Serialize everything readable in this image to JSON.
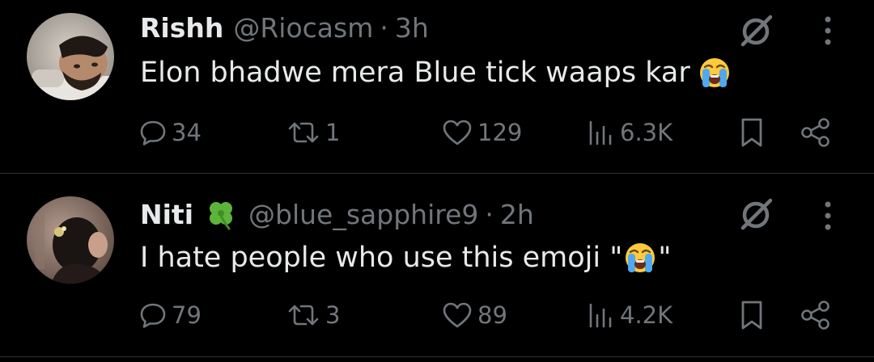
{
  "colors": {
    "background": "#000000",
    "text_primary": "#e7e9ea",
    "text_secondary": "#71767b",
    "divider": "#2f3336"
  },
  "tweets": [
    {
      "display_name": "Rishh",
      "handle": "@Riocasm",
      "separator": "·",
      "time": "3h",
      "text": "Elon bhadwe mera Blue tick waaps kar",
      "text_emoji": "loudly-crying-face-emoji",
      "stats": {
        "replies": "34",
        "retweets": "1",
        "likes": "129",
        "views": "6.3K"
      }
    },
    {
      "display_name": "Niti",
      "name_emoji": "four-leaf-clover-emoji",
      "handle": "@blue_sapphire9",
      "separator": "·",
      "time": "2h",
      "text_before": "I hate people who use this emoji \"",
      "text_emoji": "loudly-crying-face-emoji",
      "text_after": "\"",
      "stats": {
        "replies": "79",
        "retweets": "3",
        "likes": "89",
        "views": "4.2K"
      }
    }
  ],
  "icons": {
    "reply": "reply-bubble-icon",
    "retweet": "retweet-icon",
    "like": "heart-icon",
    "views": "views-bar-chart-icon",
    "bookmark": "bookmark-icon",
    "share": "share-icon",
    "grok": "grok-slash-circle-icon",
    "more": "vertical-ellipsis-icon"
  }
}
